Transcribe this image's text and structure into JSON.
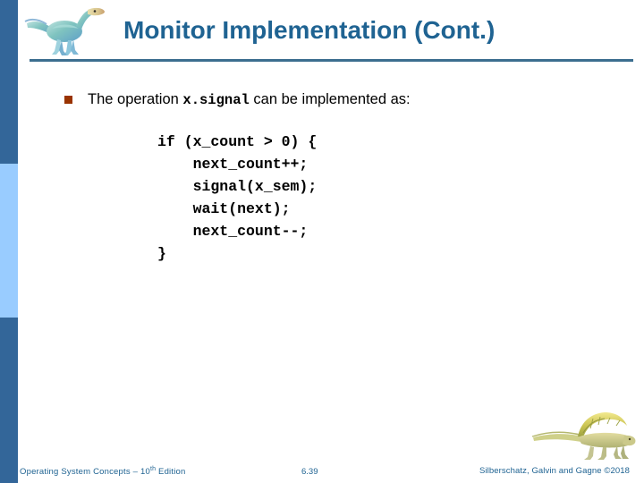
{
  "slide": {
    "title": "Monitor Implementation (Cont.)",
    "bullet": {
      "icon": "square-bullet-icon",
      "text_before": "The operation ",
      "code_term": "x.signal",
      "text_after": " can be implemented as:"
    },
    "code": "if (x_count > 0) {\n    next_count++;\n    signal(x_sem);\n    wait(next);\n    next_count--;\n}",
    "code_lines": [
      "if (x_count > 0) {",
      "    next_count++;",
      "    signal(x_sem);",
      "    wait(next);",
      "    next_count--;",
      "}"
    ]
  },
  "footer": {
    "left_prefix": "Operating System Concepts – 10",
    "left_superscript": "th",
    "left_suffix": " Edition",
    "page_number": "6.39",
    "copyright": "Silberschatz, Galvin and Gagne ©2018"
  },
  "decor": {
    "logo_dino": "dinosaur-logo-icon",
    "footer_dino": "dimetrodon-icon"
  },
  "colors": {
    "title": "#1f6392",
    "sidebar_dark": "#336699",
    "sidebar_light": "#99ccff",
    "bullet": "#993300",
    "rule": "#3c6e8f",
    "footer_text": "#1f6392"
  }
}
